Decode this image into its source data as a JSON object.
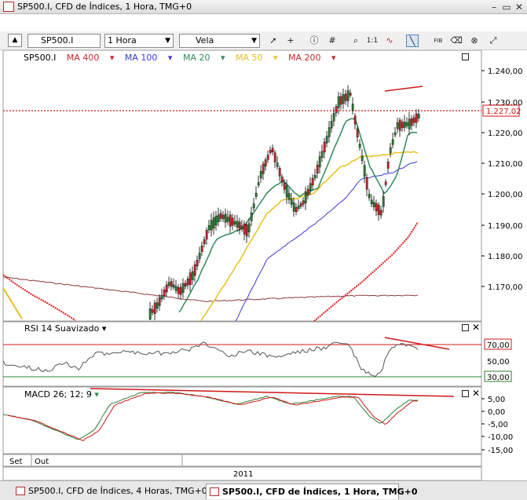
{
  "window": {
    "title": "SP500.I, CFD de Índices, 1 Hora, TMG+0"
  },
  "toolbar": {
    "symbol": "SP500.I",
    "timeframe": "1 Hora",
    "chart_style": "Vela",
    "one_to_one_label": "1:1",
    "fib_label": "FIB"
  },
  "legend": {
    "symbol": "SP500.I",
    "mas": [
      {
        "label": "MA 400",
        "color": "#c62828"
      },
      {
        "label": "MA 100",
        "color": "#3a3ad8"
      },
      {
        "label": "MA 20",
        "color": "#2e8b57"
      },
      {
        "label": "MA 50",
        "color": "#e8c020"
      },
      {
        "label": "MA 200",
        "color": "#c62828"
      }
    ]
  },
  "price_axis": {
    "ticks": [
      "1.240,00",
      "1.230,00",
      "1.220,00",
      "1.210,00",
      "1.200,00",
      "1.190,00",
      "1.180,00",
      "1.170,00"
    ],
    "current": "1.227,02"
  },
  "rsi": {
    "label": "RSI 14 Suavizado",
    "ticks": [
      "70,00",
      "50,00",
      "30,00"
    ]
  },
  "macd": {
    "label": "MACD 26; 12; 9",
    "ticks": [
      "5,00",
      "0,00",
      "-5,00",
      "-10,00",
      "-15,00"
    ]
  },
  "time_axis": {
    "months": [
      "Set",
      "Out"
    ],
    "year": "2011"
  },
  "tabs": [
    {
      "label": "SP500.I, CFD de Índices, 4 Horas, TMG+0"
    },
    {
      "label": "SP500.I, CFD de Índices, 1 Hora, TMG+0"
    }
  ],
  "colors": {
    "bull": "#2e7d32",
    "bear": "#c62828",
    "ma20": "#2e8b57",
    "ma50": "#e8c020",
    "ma100": "#3a3ad8",
    "ma200": "#e02020",
    "ma400": "#8b3a3a"
  }
}
